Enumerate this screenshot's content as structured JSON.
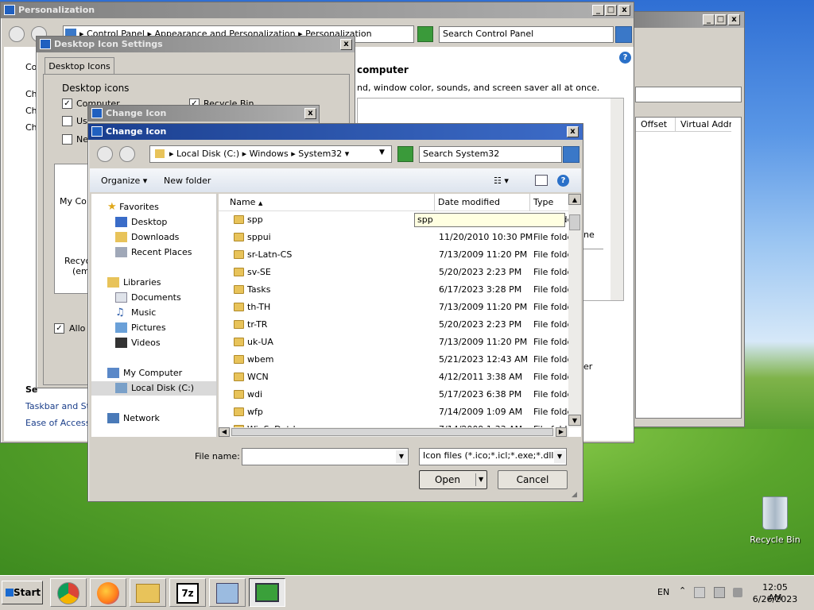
{
  "bg_window": {
    "title_buttons": [
      "_",
      "□",
      "x"
    ],
    "column_offset": "Offset",
    "column_virtual": "Virtual Addre"
  },
  "personalization": {
    "title": "Personalization",
    "breadcrumb": [
      "Control Panel",
      "Appearance and Personalization",
      "Personalization"
    ],
    "search_placeholder": "Search Control Panel",
    "heading": "computer",
    "desc": "nd, window color, sounds, and screen saver all at once.",
    "side_links": [
      "Co",
      "Ch",
      "Ch",
      "Ch"
    ],
    "see_also": "Se",
    "links": [
      "Taskbar and Sta",
      "Ease of Access C"
    ],
    "tail_ne": "ne",
    "tail_er": "er"
  },
  "desktop_icon_settings": {
    "title": "Desktop Icon Settings",
    "tab": "Desktop Icons",
    "group": "Desktop icons",
    "checkboxes": [
      {
        "label": "Computer",
        "checked": true
      },
      {
        "label": "Us",
        "checked": false
      },
      {
        "label": "Ne",
        "checked": false
      },
      {
        "label": "Recycle Bin",
        "checked": true
      }
    ],
    "my_computer_label": "My Co",
    "recycle_label": "Recyc",
    "recycle_sub": "(em",
    "allow_label": "Allo"
  },
  "change_icon_inactive": {
    "title": "Change Icon"
  },
  "change_icon": {
    "title": "Change Icon",
    "path": [
      "Local Disk (C:)",
      "Windows",
      "System32"
    ],
    "search_placeholder": "Search System32",
    "organize": "Organize",
    "new_folder": "New folder",
    "col_name": "Name",
    "col_date": "Date modified",
    "col_type": "Type",
    "tooltip": "spp",
    "nav": {
      "favorites": "Favorites",
      "fav_items": [
        "Desktop",
        "Downloads",
        "Recent Places"
      ],
      "libraries": "Libraries",
      "lib_items": [
        "Documents",
        "Music",
        "Pictures",
        "Videos"
      ],
      "computer": "My Computer",
      "drive": "Local Disk (C:)",
      "network": "Network"
    },
    "files": [
      {
        "name": "spp",
        "date": "",
        "type": "File folder"
      },
      {
        "name": "sppui",
        "date": "11/20/2010 10:30 PM",
        "type": "File folder"
      },
      {
        "name": "sr-Latn-CS",
        "date": "7/13/2009 11:20 PM",
        "type": "File folder"
      },
      {
        "name": "sv-SE",
        "date": "5/20/2023 2:23 PM",
        "type": "File folder"
      },
      {
        "name": "Tasks",
        "date": "6/17/2023 3:28 PM",
        "type": "File folder"
      },
      {
        "name": "th-TH",
        "date": "7/13/2009 11:20 PM",
        "type": "File folder"
      },
      {
        "name": "tr-TR",
        "date": "5/20/2023 2:23 PM",
        "type": "File folder"
      },
      {
        "name": "uk-UA",
        "date": "7/13/2009 11:20 PM",
        "type": "File folder"
      },
      {
        "name": "wbem",
        "date": "5/21/2023 12:43 AM",
        "type": "File folder"
      },
      {
        "name": "WCN",
        "date": "4/12/2011 3:38 AM",
        "type": "File folder"
      },
      {
        "name": "wdi",
        "date": "5/17/2023 6:38 PM",
        "type": "File folder"
      },
      {
        "name": "wfp",
        "date": "7/14/2009 1:09 AM",
        "type": "File folder"
      },
      {
        "name": "WinSxDotd",
        "date": "7/14/2009 1:33 AM",
        "type": "File folder"
      }
    ],
    "filename_label": "File name:",
    "filename_value": "",
    "filter": "Icon files (*.ico;*.icl;*.exe;*.dll)",
    "open": "Open",
    "cancel": "Cancel"
  },
  "desktop": {
    "recycle_bin": "Recycle Bin"
  },
  "taskbar": {
    "start": "Start",
    "lang": "EN",
    "time": "12:05 AM",
    "date": "6/26/2023"
  }
}
